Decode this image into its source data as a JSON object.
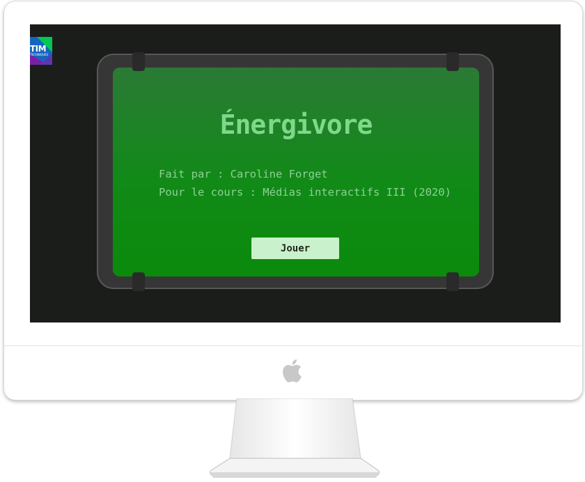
{
  "logo": {
    "text": "TIM",
    "subtext": "TECHNIQUES",
    "colors": [
      "#1e88e5",
      "#00c853",
      "#7b1fa2"
    ]
  },
  "game": {
    "title": "Énergivore",
    "credit_author": "Fait par : Caroline Forget",
    "credit_course": "Pour le cours : Médias interactifs III (2020)",
    "play_label": "Jouer"
  },
  "colors": {
    "screen_bg": "#1b1d1a",
    "panel_green": "#0b8a0c",
    "title_green": "#7fd88a",
    "button_bg": "#c9f1cb"
  },
  "icons": {
    "apple": "apple-logo-icon"
  }
}
